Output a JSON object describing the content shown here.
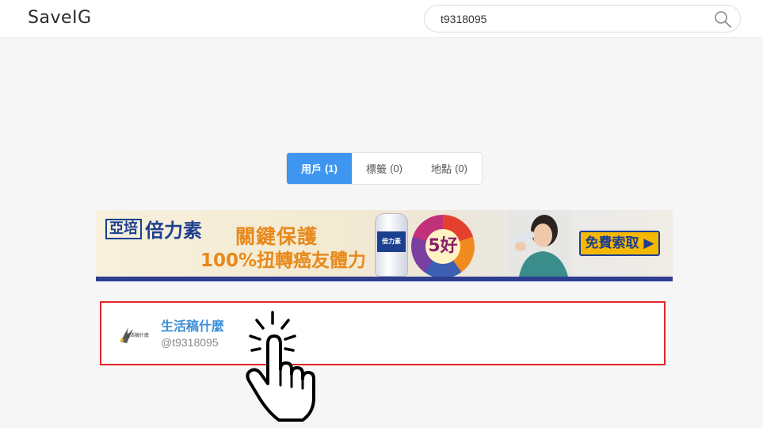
{
  "header": {
    "logo": "SaveIG",
    "search": {
      "value": "t9318095",
      "placeholder": ""
    }
  },
  "tabs": [
    {
      "label": "用戶",
      "count": "(1)",
      "active": true
    },
    {
      "label": "標籤",
      "count": "(0)",
      "active": false
    },
    {
      "label": "地點",
      "count": "(0)",
      "active": false
    }
  ],
  "ad": {
    "brand_box": "亞培",
    "brand_name": "倍力素",
    "headline": "關鍵保護",
    "subline": "100%扭轉癌友體力",
    "bottle_label": "倍力素",
    "wheel_text": "5好",
    "cta": "免費索取"
  },
  "results": [
    {
      "name": "生活稿什麼",
      "handle": "@t9318095",
      "avatar_text": "生活稿什麼"
    }
  ],
  "colors": {
    "accent": "#3e96f1",
    "highlight_border": "#e0252b",
    "link": "#3b8fd6",
    "ad_cta": "#f5b800"
  },
  "icons": [
    "search-icon",
    "pointing-hand-cursor-icon"
  ]
}
